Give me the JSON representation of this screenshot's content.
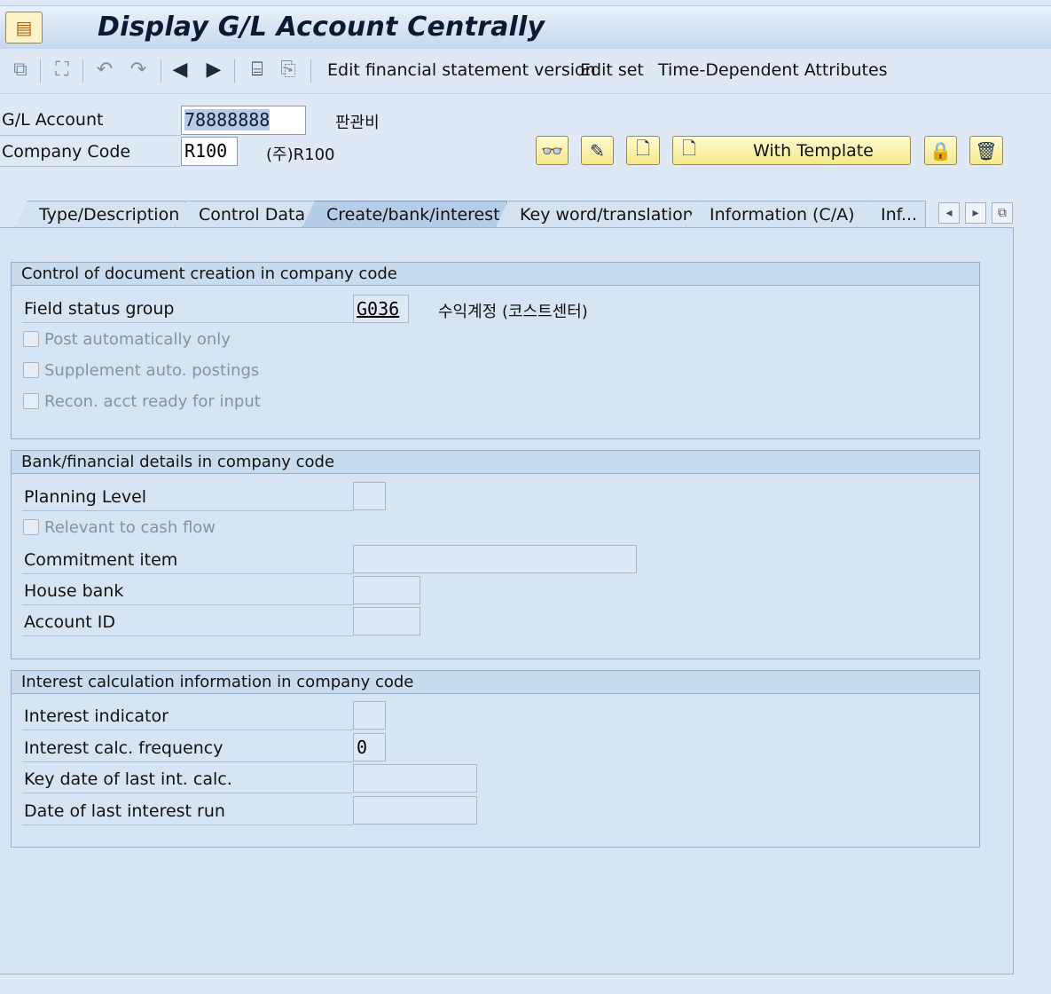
{
  "window": {
    "title": "Display G/L Account Centrally"
  },
  "toolbar": {
    "icons": [
      "other-object-icon",
      "where-used-icon",
      "undo-icon",
      "redo-icon",
      "previous-icon",
      "next-icon",
      "display-coa-icon",
      "display-company-code-icon"
    ],
    "edit_fsv_label": "Edit financial statement version",
    "edit_set_label": "Edit set",
    "time_dep_label": "Time-Dependent Attributes"
  },
  "header": {
    "gl_account_label": "G/L Account",
    "gl_account_value": "78888888",
    "gl_account_desc": "판관비",
    "company_code_label": "Company Code",
    "company_code_value": "R100",
    "company_code_desc": "(주)R100",
    "with_template_label": "With Template"
  },
  "tabs": [
    {
      "label": "Type/Description",
      "active": false
    },
    {
      "label": "Control Data",
      "active": false
    },
    {
      "label": "Create/bank/interest",
      "active": true
    },
    {
      "label": "Key word/translation",
      "active": false
    },
    {
      "label": "Information (C/A)",
      "active": false
    },
    {
      "label": "Inf...",
      "active": false
    }
  ],
  "groups": {
    "doc_creation": {
      "title": "Control of document creation in company code",
      "field_status_group_label": "Field status group",
      "field_status_group_value": "G036",
      "field_status_group_desc": "수익계정 (코스트센터)",
      "post_auto_label": "Post automatically only",
      "supplement_label": "Supplement auto. postings",
      "recon_label": "Recon. acct ready for input"
    },
    "bank": {
      "title": "Bank/financial details in company code",
      "planning_level_label": "Planning Level",
      "planning_level_value": "",
      "cash_flow_label": "Relevant to cash flow",
      "commitment_item_label": "Commitment item",
      "commitment_item_value": "",
      "house_bank_label": "House bank",
      "house_bank_value": "",
      "account_id_label": "Account ID",
      "account_id_value": ""
    },
    "interest": {
      "title": "Interest calculation information in company code",
      "indicator_label": "Interest indicator",
      "indicator_value": "",
      "frequency_label": "Interest calc. frequency",
      "frequency_value": "0",
      "key_date_label": "Key date of last int. calc.",
      "key_date_value": "",
      "last_run_label": "Date of last interest run",
      "last_run_value": ""
    }
  },
  "colors": {
    "background": "#dfe9f5",
    "panel": "#d6e4f4",
    "button_yellow": "#f6e98b",
    "active_tab": "#b6cde8"
  }
}
